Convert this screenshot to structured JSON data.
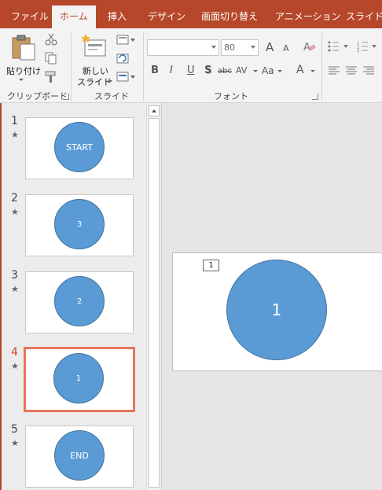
{
  "tabs": [
    {
      "label": "ファイル",
      "active": false
    },
    {
      "label": "ホーム",
      "active": true
    },
    {
      "label": "挿入",
      "active": false
    },
    {
      "label": "デザイン",
      "active": false
    },
    {
      "label": "画面切り替え",
      "active": false
    },
    {
      "label": "アニメーション",
      "active": false
    },
    {
      "label": "スライド シ",
      "active": false
    }
  ],
  "ribbon": {
    "clipboard": {
      "paste_label": "貼り付け",
      "group_label": "クリップボード",
      "icons": [
        "paste-icon",
        "cut-icon",
        "copy-icon",
        "format-painter-icon"
      ]
    },
    "slides": {
      "new_slide_line1": "新しい",
      "new_slide_line2": "スライド",
      "group_label": "スライド",
      "icons": [
        "new-slide-icon",
        "layout-icon",
        "reset-icon",
        "section-icon"
      ]
    },
    "font": {
      "font_name": "",
      "font_size": "80",
      "group_label": "フォント",
      "buttons": {
        "bold": "B",
        "italic": "I",
        "underline": "U",
        "shadow": "S",
        "strike": "abc",
        "spacing": "AV",
        "case": "Aa",
        "color": "A",
        "grow": "A",
        "shrink": "A"
      }
    },
    "paragraph": {
      "icons": [
        "bullets-icon",
        "numbering-icon",
        "align-left-icon",
        "align-center-icon",
        "align-right-icon"
      ]
    }
  },
  "slides": [
    {
      "number": "1",
      "label": "START",
      "star": "★",
      "selected": false
    },
    {
      "number": "2",
      "label": "3",
      "star": "★",
      "selected": false
    },
    {
      "number": "3",
      "label": "2",
      "star": "★",
      "selected": false
    },
    {
      "number": "4",
      "label": "1",
      "star": "★",
      "selected": true
    },
    {
      "number": "5",
      "label": "END",
      "star": "★",
      "selected": false
    }
  ],
  "editor": {
    "animation_tag": "1",
    "circle_label": "1"
  },
  "colors": {
    "accent": "#b7472a",
    "shape_fill": "#5b9bd5",
    "shape_border": "#41719c",
    "selection": "#e6765b"
  }
}
